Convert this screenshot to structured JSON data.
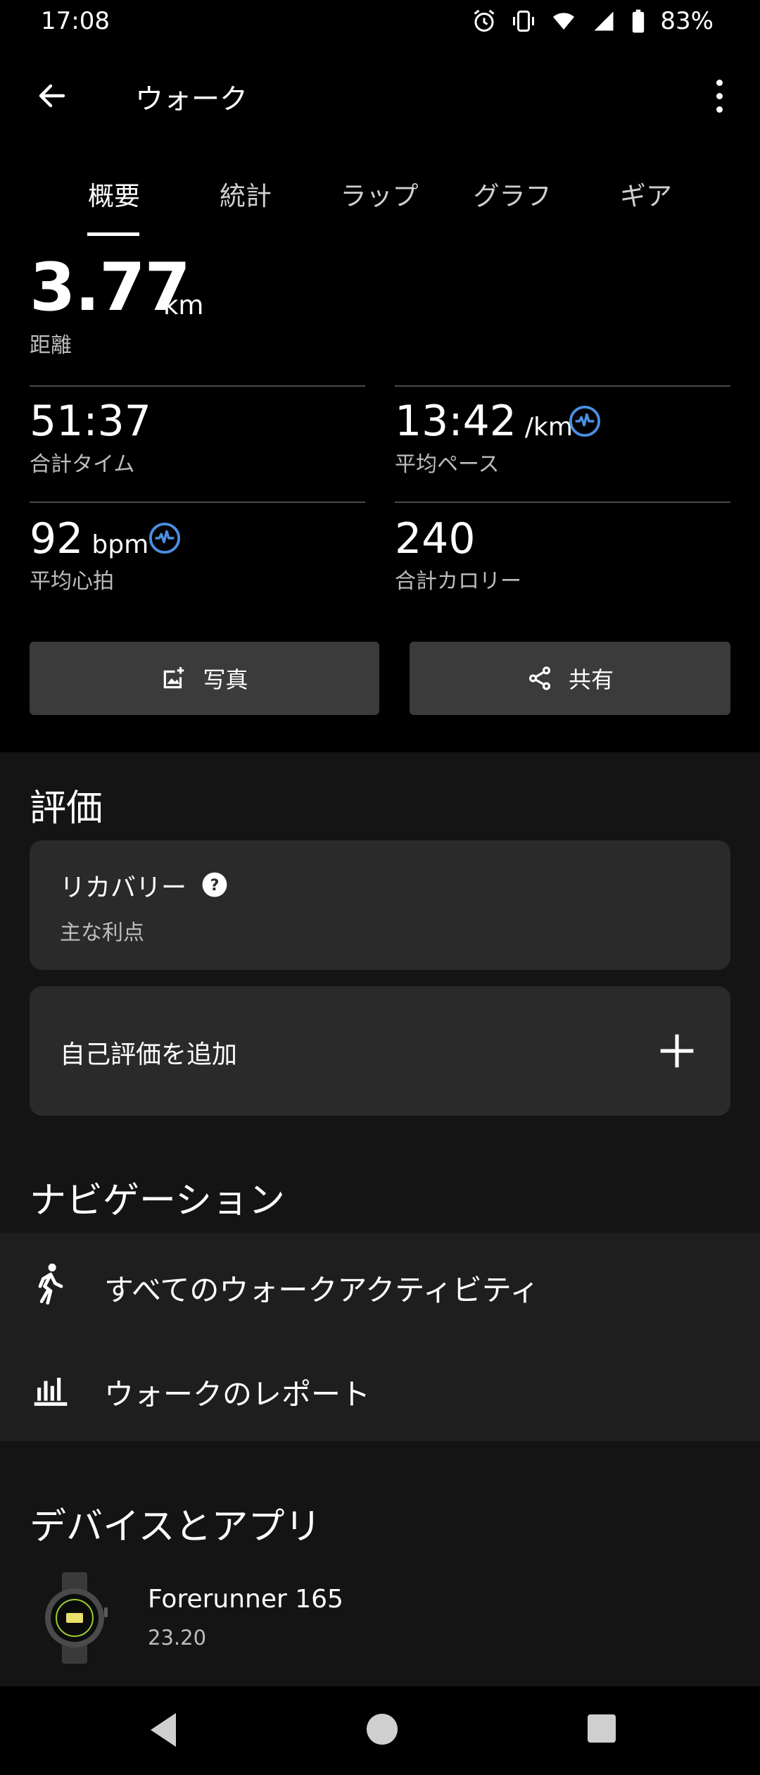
{
  "status_bar": {
    "time": "17:08",
    "battery": "83%"
  },
  "header": {
    "title": "ウォーク"
  },
  "tabs": [
    {
      "label": "概要",
      "active": true
    },
    {
      "label": "統計",
      "active": false
    },
    {
      "label": "ラップ",
      "active": false
    },
    {
      "label": "グラフ",
      "active": false
    },
    {
      "label": "ギア",
      "active": false
    }
  ],
  "summary": {
    "distance": {
      "value": "3.77",
      "unit": "km",
      "label": "距離"
    },
    "total_time": {
      "value": "51:37",
      "label": "合計タイム"
    },
    "avg_pace": {
      "value": "13:42",
      "unit": "/km",
      "label": "平均ペース"
    },
    "avg_hr": {
      "value": "92",
      "unit": "bpm",
      "label": "平均心拍"
    },
    "calories": {
      "value": "240",
      "label": "合計カロリー"
    }
  },
  "actions": {
    "photo": "写真",
    "share": "共有"
  },
  "evaluation": {
    "title": "評価",
    "recovery_title": "リカバリー",
    "recovery_sub": "主な利点",
    "self_eval": "自己評価を追加"
  },
  "navigation": {
    "title": "ナビゲーション",
    "items": [
      {
        "label": "すべてのウォークアクティビティ"
      },
      {
        "label": "ウォークのレポート"
      }
    ]
  },
  "devices": {
    "title": "デバイスとアプリ",
    "device_name": "Forerunner 165",
    "device_version": "23.20"
  },
  "colors": {
    "accent": "#4a90e2",
    "card": "#2a2a2a",
    "button": "#3b3b3b"
  }
}
